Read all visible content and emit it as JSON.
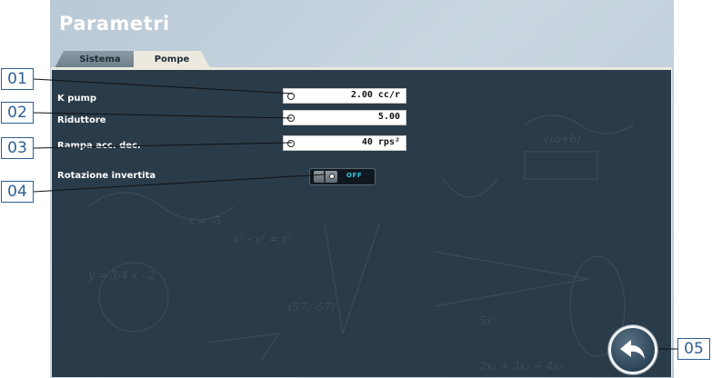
{
  "window": {
    "title": "Parametri"
  },
  "tabs": [
    {
      "label": "Sistema",
      "active": false
    },
    {
      "label": "Pompe",
      "active": true
    }
  ],
  "parameters": [
    {
      "label": "K pump",
      "value": "2.00 cc/r"
    },
    {
      "label": "Riduttore",
      "value": "5.00"
    },
    {
      "label": "Rampa acc. dec.",
      "value": "40 rps²"
    }
  ],
  "rotation": {
    "label": "Rotazione invertita",
    "state": "OFF"
  },
  "callouts": [
    "01",
    "02",
    "03",
    "04",
    "05"
  ],
  "icons": {
    "back": "back-arrow-icon",
    "radio": "circle-indicator-icon"
  },
  "colors": {
    "panel": "#2a3b49",
    "background": "#c3d1dc",
    "callout": "#2f5f93",
    "toggle_state": "#36c9e6"
  }
}
